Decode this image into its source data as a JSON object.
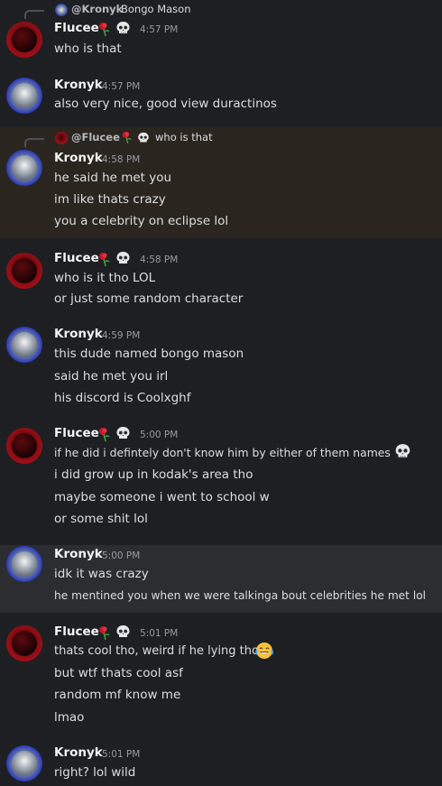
{
  "users": {
    "flucee": {
      "name": "Flucee",
      "avatar": "flucee-avatar"
    },
    "kronyk": {
      "name": "Kronyk",
      "avatar": "kronyk-avatar"
    }
  },
  "messages": [
    {
      "reply": {
        "at": "@Kronyk",
        "text": "Bongo Mason"
      },
      "author": "Flucee",
      "time": "4:57 PM",
      "lines": [
        "who is that"
      ]
    },
    {
      "author": "Kronyk",
      "time": "4:57 PM",
      "lines": [
        "also very nice, good view duractinos"
      ]
    },
    {
      "reply": {
        "at": "@Flucee",
        "text": "who is that"
      },
      "author": "Kronyk",
      "time": "4:58 PM",
      "lines": [
        "he said he met you",
        "im like thats crazy",
        "you a celebrity on eclipse lol"
      ]
    },
    {
      "author": "Flucee",
      "time": "4:58 PM",
      "lines": [
        "who is it tho LOL",
        "or just some random character"
      ]
    },
    {
      "author": "Kronyk",
      "time": "4:59 PM",
      "lines": [
        "this dude named bongo mason",
        "said he met you irl",
        "his discord is Coolxghf"
      ]
    },
    {
      "author": "Flucee",
      "time": "5:00 PM",
      "lines": [
        "if he did i defintely don't know him by either of them names",
        "i did grow up in kodak's area tho",
        "maybe someone i went to school w",
        "or some shit lol"
      ]
    },
    {
      "author": "Kronyk",
      "time": "5:00 PM",
      "lines": [
        "idk it was crazy",
        "he mentined you when we were talkinga bout celebrities he met lol"
      ]
    },
    {
      "author": "Flucee",
      "time": "5:01 PM",
      "lines": [
        "thats cool tho, weird if he lying tho",
        "but wtf thats cool asf",
        "random mf know me",
        "lmao"
      ]
    },
    {
      "author": "Kronyk",
      "time": "5:01 PM",
      "lines": [
        "right? lol wild"
      ]
    }
  ],
  "colors": {
    "background": "#1e1f22",
    "mention_highlight": "#2b2520",
    "hover_highlight": "#2b2d31",
    "timestamp": "#949ba4"
  },
  "icons": [
    "rose-emoji",
    "skull-emoji",
    "joy-emoji"
  ]
}
